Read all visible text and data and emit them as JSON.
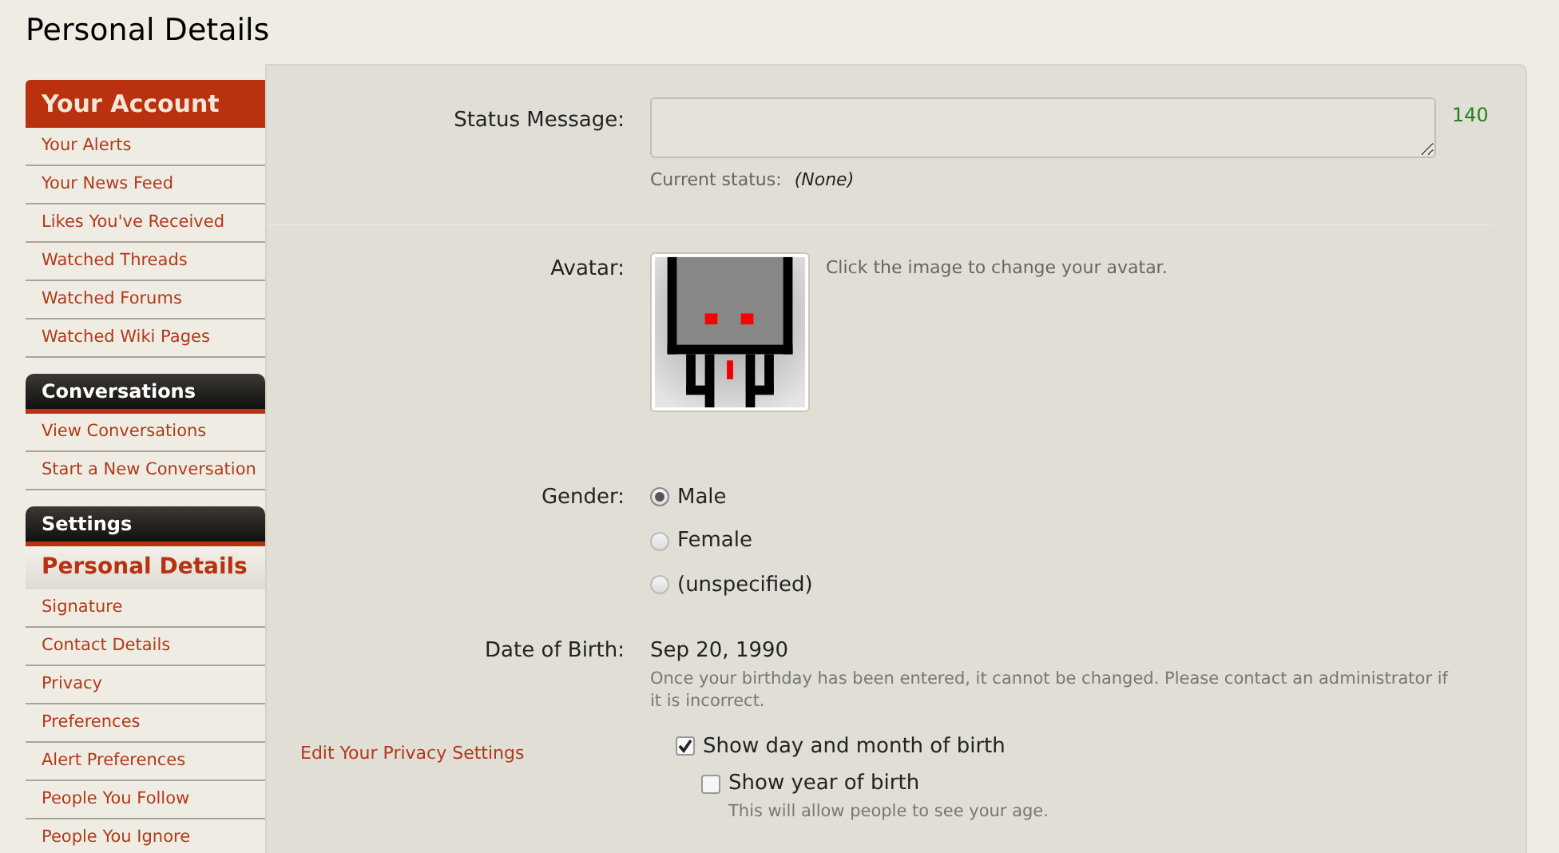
{
  "page_title": "Personal Details",
  "sidebar": {
    "sections": [
      {
        "title": "Your Account",
        "kind": "primary",
        "items": [
          {
            "label": "Your Alerts",
            "selected": false
          },
          {
            "label": "Your News Feed",
            "selected": false
          },
          {
            "label": "Likes You've Received",
            "selected": false
          },
          {
            "label": "Watched Threads",
            "selected": false
          },
          {
            "label": "Watched Forums",
            "selected": false
          },
          {
            "label": "Watched Wiki Pages",
            "selected": false
          }
        ]
      },
      {
        "title": "Conversations",
        "kind": "dark",
        "items": [
          {
            "label": "View Conversations",
            "selected": false
          },
          {
            "label": "Start a New Conversation",
            "selected": false
          }
        ]
      },
      {
        "title": "Settings",
        "kind": "dark",
        "items": [
          {
            "label": "Personal Details",
            "selected": true
          },
          {
            "label": "Signature",
            "selected": false
          },
          {
            "label": "Contact Details",
            "selected": false
          },
          {
            "label": "Privacy",
            "selected": false
          },
          {
            "label": "Preferences",
            "selected": false
          },
          {
            "label": "Alert Preferences",
            "selected": false
          },
          {
            "label": "People You Follow",
            "selected": false
          },
          {
            "label": "People You Ignore",
            "selected": false
          }
        ]
      }
    ]
  },
  "form": {
    "status_message": {
      "label": "Status Message:",
      "counter": "140",
      "current_label": "Current status:",
      "current_value": "(None)"
    },
    "avatar": {
      "label": "Avatar:",
      "hint": "Click the image to change your avatar."
    },
    "gender": {
      "label": "Gender:",
      "options": [
        {
          "label": "Male",
          "selected": true
        },
        {
          "label": "Female",
          "selected": false
        },
        {
          "label": "(unspecified)",
          "selected": false
        }
      ]
    },
    "date_of_birth": {
      "label": "Date of Birth:",
      "value": "Sep 20, 1990",
      "note": "Once your birthday has been entered, it cannot be changed. Please contact an administrator if it is incorrect."
    },
    "privacy": {
      "link": "Edit Your Privacy Settings",
      "options": [
        {
          "label": "Show day and month of birth",
          "checked": true
        },
        {
          "label": "Show year of birth",
          "checked": false,
          "hint": "This will allow people to see your age."
        }
      ]
    }
  }
}
